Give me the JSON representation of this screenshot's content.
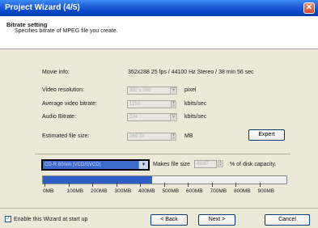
{
  "window": {
    "title": "Project Wizard (4/5)",
    "close_glyph": "✕",
    "close_icon": "close-icon"
  },
  "header": {
    "title": "Bitrate setting",
    "description": "Specifies bitrate of MPEG file you create."
  },
  "movie_info": {
    "label": "Movie info:",
    "value": "352x288 25 fps / 44100 Hz Stereo / 38 min 56 sec"
  },
  "video_resolution": {
    "label": "Video resolution:",
    "value": "352 x 288",
    "unit": "pixel"
  },
  "average_video_bitrate": {
    "label": "Average video bitrate:",
    "value": "1150",
    "unit": "kbits/sec"
  },
  "audio_bitrate": {
    "label": "Audio Bitrate:",
    "value": "224",
    "unit": "kbits/sec"
  },
  "estimated_file_size": {
    "label": "Estimated file size:",
    "value": "369.33",
    "unit": "MB"
  },
  "expert_button": {
    "label": "Expert"
  },
  "media": {
    "selected": "CD-R 80min (VCD/SVCD)",
    "makes_file_size_label": "Makes file size",
    "percent_value": "49.87",
    "percent_label": "% of disk capacity."
  },
  "capacity_bar": {
    "fill_fraction": 0.45,
    "tick_labels": [
      "0MB",
      "100MB",
      "200MB",
      "300MB",
      "400MB",
      "500MB",
      "600MB",
      "700MB",
      "800MB",
      "900MB"
    ],
    "fill_color": "#2e5fc6"
  },
  "footer": {
    "startup_checkbox_label": "Enable this Wizard at start up",
    "startup_checked": true,
    "back_label": "< Back",
    "next_label": "Next >",
    "cancel_label": "Cancel"
  },
  "colors": {
    "title_bar": "#0a48c8",
    "close_button": "#d6452b",
    "dialog_bg": "#ece9d8",
    "selection": "#3b6ccd"
  }
}
